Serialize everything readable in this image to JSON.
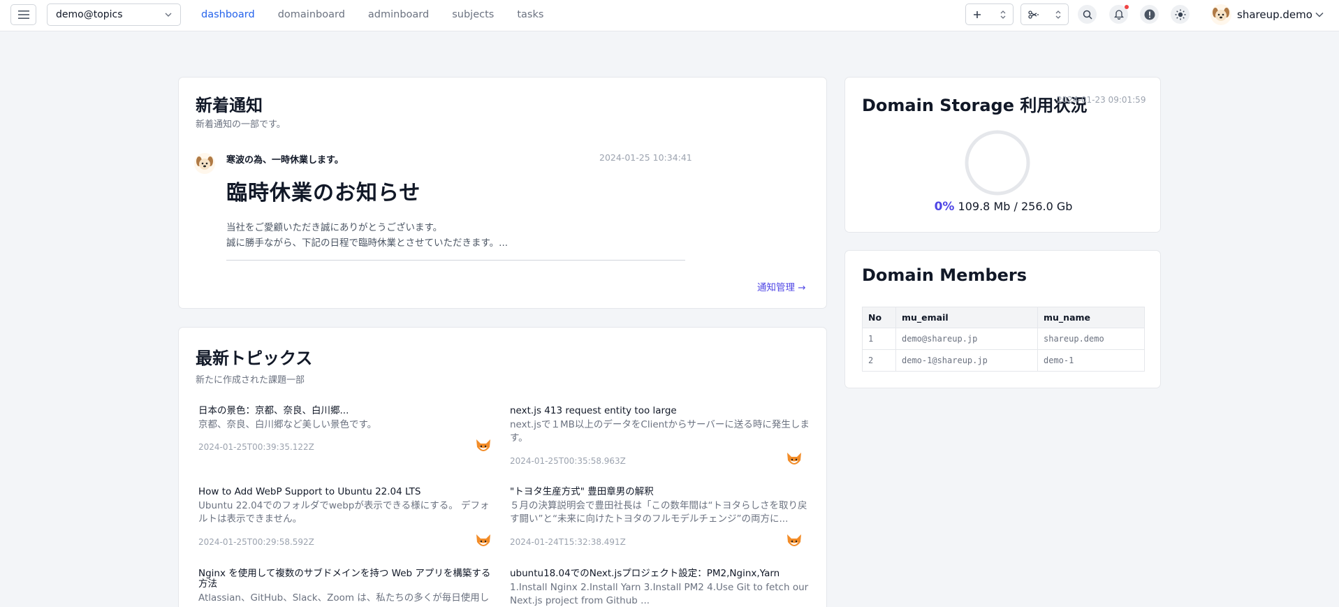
{
  "header": {
    "domain_select": "demo@topics",
    "nav": [
      {
        "label": "dashboard",
        "active": true
      },
      {
        "label": "domainboard",
        "active": false
      },
      {
        "label": "adminboard",
        "active": false
      },
      {
        "label": "subjects",
        "active": false
      },
      {
        "label": "tasks",
        "active": false
      }
    ],
    "user_name": "shareup.demo",
    "icons": [
      "menu-icon",
      "plus-icon",
      "scissors-icon",
      "search-icon",
      "bell-icon",
      "alert-icon",
      "sun-icon"
    ],
    "accent_color": "#2563eb"
  },
  "notifications": {
    "title": "新着通知",
    "subtitle": "新着通知の一部です。",
    "item": {
      "title": "寒波の為、一時休業します。",
      "date": "2024-01-25 10:34:41",
      "headline": "臨時休業のお知らせ",
      "body_line1": "当社をご愛顧いただき誠にありがとうございます。",
      "body_line2": "誠に勝手ながら、下記の日程で臨時休業とさせていただきます。..."
    },
    "manage_link": "通知管理 →"
  },
  "topics": {
    "title": "最新トピックス",
    "subtitle": "新たに作成された課題一部",
    "items": [
      {
        "title": "日本の景色：京都、奈良、白川郷...",
        "desc": "京都、奈良、白川郷など美しい景色です。",
        "date": "2024-01-25T00:39:35.122Z"
      },
      {
        "title": "next.js 413 request entity too large",
        "desc": "next.jsで１MB以上のデータをClientからサーバーに送る時に発生します。",
        "date": "2024-01-25T00:35:58.963Z"
      },
      {
        "title": "How to Add WebP Support to Ubuntu 22.04 LTS",
        "desc": "Ubuntu 22.04でのフォルダでwebpが表示できる様にする。 デフォルトは表示できません。",
        "date": "2024-01-25T00:29:58.592Z"
      },
      {
        "title": "\"トヨタ生産方式\" 豊田章男の解釈",
        "desc": "５月の決算説明会で豊田社長は「この数年間は“トヨタらしさを取り戻す闘い”と“未来に向けたトヨタのフルモデルチェンジ”の両方に...",
        "date": "2024-01-24T15:32:38.491Z"
      },
      {
        "title": "Nginx を使用して複数のサブドメインを持つ Web アプリを構築する方法",
        "desc": "Atlassian、GitHub、Slack、Zoom は、私たちの多くが毎日使用し",
        "date": ""
      },
      {
        "title": "ubuntu18.04でのNext.jsプロジェクト設定：PM2,Nginx,Yarn",
        "desc": "1.Install Nginx 2.Install Yarn 3.Install PM2 4.Use Git to fetch our Next.js project from Github ...",
        "date": ""
      }
    ]
  },
  "storage": {
    "title": "Domain Storage 利用状況",
    "date": "2024-01-23 09:01:59",
    "percent": "0%",
    "usage": "109.8 Mb / 256.0 Gb"
  },
  "members": {
    "title": "Domain Members",
    "columns": [
      "No",
      "mu_email",
      "mu_name"
    ],
    "rows": [
      [
        "1",
        "demo@shareup.jp",
        "shareup.demo"
      ],
      [
        "2",
        "demo-1@shareup.jp",
        "demo-1"
      ]
    ]
  }
}
